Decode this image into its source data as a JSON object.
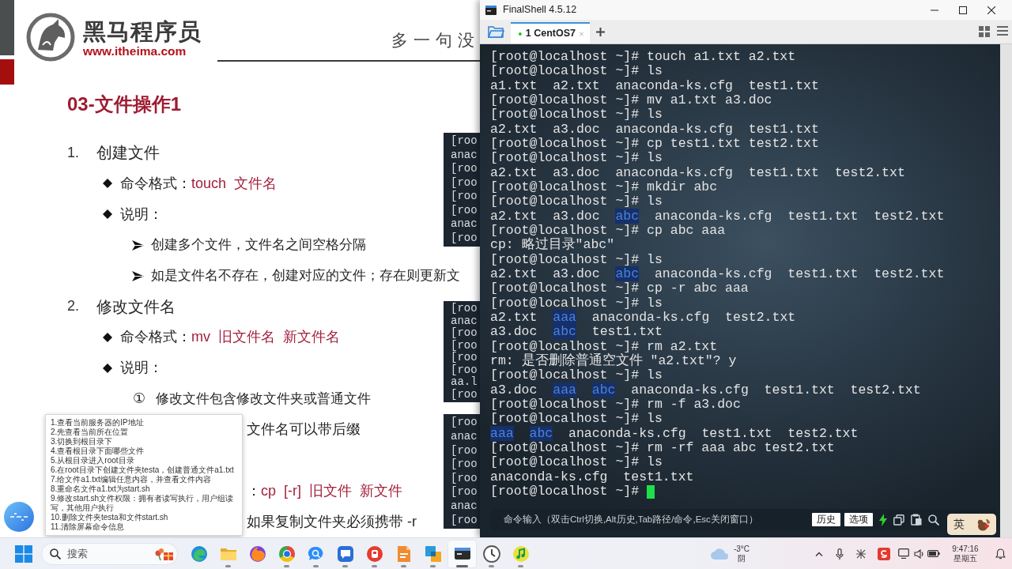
{
  "slide": {
    "logo": {
      "name": "黑马程序员",
      "url": "www.itheima.com"
    },
    "header": "多一句没",
    "title": "03-文件操作1",
    "sections": [
      {
        "number": "1.",
        "heading": "创建文件",
        "items": [
          {
            "kind": "command",
            "label": "命令格式：",
            "command": "touch  文件名"
          },
          {
            "kind": "note",
            "label": "说明：",
            "points": [
              {
                "kind": "arrow",
                "text": "创建多个文件，文件名之间空格分隔"
              },
              {
                "kind": "arrow",
                "text": "如是文件名不存在，创建对应的文件；存在则更新文"
              }
            ]
          }
        ]
      },
      {
        "number": "2.",
        "heading": "修改文件名",
        "items": [
          {
            "kind": "command",
            "label": "命令格式：",
            "command": "mv  旧文件名  新文件名"
          },
          {
            "kind": "note",
            "label": "说明：",
            "points": [
              {
                "kind": "circled",
                "symbol": "①",
                "text": "修改文件包含修改文件夹或普通文件"
              }
            ]
          }
        ]
      }
    ],
    "covered_lines": [
      {
        "kind": "text",
        "text": "文件名可以带后缀"
      },
      {
        "kind": "command",
        "label": "：",
        "command": "cp  [-r]  旧文件  新文件"
      },
      {
        "kind": "text",
        "text": "如果复制文件夹必须携带 -r"
      }
    ],
    "code_blocks": [
      {
        "lines": [
          "[roo",
          "anac",
          "[roo",
          "[roo",
          "[roo",
          "[roo",
          "anac",
          "[roo"
        ]
      },
      {
        "lines": [
          "[roo",
          "anac",
          "[roo",
          "[roo",
          "[roo",
          "[roo",
          "aa.l",
          "[roo"
        ]
      },
      {
        "lines": [
          "[roo",
          "anac",
          "[roo",
          "[roo",
          "[roo",
          "[roo",
          "anac",
          "[roo"
        ]
      }
    ]
  },
  "terminal": {
    "title": "FinalShell 4.5.12",
    "tabs": [
      {
        "label": "1 CentOS7",
        "selected": true,
        "connected": true
      }
    ],
    "lines": [
      {
        "parts": [
          {
            "text": "[root@localhost ~]# touch a1.txt a2.txt",
            "kind": "plain"
          }
        ]
      },
      {
        "parts": [
          {
            "text": "[root@localhost ~]# ls",
            "kind": "plain"
          }
        ]
      },
      {
        "parts": [
          {
            "text": "a1.txt  a2.txt  anaconda-ks.cfg  test1.txt",
            "kind": "plain"
          }
        ]
      },
      {
        "parts": [
          {
            "text": "[root@localhost ~]# mv a1.txt a3.doc",
            "kind": "plain"
          }
        ]
      },
      {
        "parts": [
          {
            "text": "[root@localhost ~]# ls",
            "kind": "plain"
          }
        ]
      },
      {
        "parts": [
          {
            "text": "a2.txt  a3.doc  anaconda-ks.cfg  test1.txt",
            "kind": "plain"
          }
        ]
      },
      {
        "parts": [
          {
            "text": "[root@localhost ~]# cp test1.txt test2.txt",
            "kind": "plain"
          }
        ]
      },
      {
        "parts": [
          {
            "text": "[root@localhost ~]# ls",
            "kind": "plain"
          }
        ]
      },
      {
        "parts": [
          {
            "text": "a2.txt  a3.doc  anaconda-ks.cfg  test1.txt  test2.txt",
            "kind": "plain"
          }
        ]
      },
      {
        "parts": [
          {
            "text": "[root@localhost ~]# mkdir abc",
            "kind": "plain"
          }
        ]
      },
      {
        "parts": [
          {
            "text": "[root@localhost ~]# ls",
            "kind": "plain"
          }
        ]
      },
      {
        "parts": [
          {
            "text": "a2.txt  a3.doc",
            "kind": "plain"
          },
          {
            "text": "abc",
            "kind": "dir"
          },
          {
            "text": "anaconda-ks.cfg  test1.txt  test2.txt",
            "kind": "plain"
          }
        ]
      },
      {
        "parts": [
          {
            "text": "[root@localhost ~]# cp abc aaa",
            "kind": "plain"
          }
        ]
      },
      {
        "parts": [
          {
            "text": "cp: 略过目录\"abc\"",
            "kind": "plain"
          }
        ]
      },
      {
        "parts": [
          {
            "text": "[root@localhost ~]# ls",
            "kind": "plain"
          }
        ]
      },
      {
        "parts": [
          {
            "text": "a2.txt  a3.doc",
            "kind": "plain"
          },
          {
            "text": "abc",
            "kind": "dir"
          },
          {
            "text": "anaconda-ks.cfg  test1.txt  test2.txt",
            "kind": "plain"
          }
        ]
      },
      {
        "parts": [
          {
            "text": "[root@localhost ~]# cp -r abc aaa",
            "kind": "plain"
          }
        ]
      },
      {
        "parts": [
          {
            "text": "[root@localhost ~]# ls",
            "kind": "plain"
          }
        ]
      },
      {
        "parts": [
          {
            "text": "a2.txt",
            "kind": "plain"
          },
          {
            "text": "aaa",
            "kind": "dir"
          },
          {
            "text": "anaconda-ks.cfg  test2.txt",
            "kind": "plain"
          }
        ]
      },
      {
        "parts": [
          {
            "text": "a3.doc",
            "kind": "plain"
          },
          {
            "text": "abc",
            "kind": "dir"
          },
          {
            "text": "test1.txt",
            "kind": "plain"
          }
        ]
      },
      {
        "parts": [
          {
            "text": "[root@localhost ~]# rm a2.txt",
            "kind": "plain"
          }
        ]
      },
      {
        "parts": [
          {
            "text": "rm: 是否删除普通空文件 \"a2.txt\"? y",
            "kind": "plain"
          }
        ]
      },
      {
        "parts": [
          {
            "text": "[root@localhost ~]# ls",
            "kind": "plain"
          }
        ]
      },
      {
        "parts": [
          {
            "text": "a3.doc",
            "kind": "plain"
          },
          {
            "text": "aaa",
            "kind": "dir"
          },
          {
            "text": "abc",
            "kind": "dir"
          },
          {
            "text": "anaconda-ks.cfg  test1.txt  test2.txt",
            "kind": "plain"
          }
        ]
      },
      {
        "parts": [
          {
            "text": "[root@localhost ~]# rm -f a3.doc",
            "kind": "plain"
          }
        ]
      },
      {
        "parts": [
          {
            "text": "[root@localhost ~]# ls",
            "kind": "plain"
          }
        ]
      },
      {
        "parts": [
          {
            "text": "aaa",
            "kind": "dir"
          },
          {
            "text": "abc",
            "kind": "dir"
          },
          {
            "text": "anaconda-ks.cfg  test1.txt  test2.txt",
            "kind": "plain"
          }
        ]
      },
      {
        "parts": [
          {
            "text": "[root@localhost ~]# rm -rf aaa abc test2.txt",
            "kind": "plain"
          }
        ]
      },
      {
        "parts": [
          {
            "text": "[root@localhost ~]# ls",
            "kind": "plain"
          }
        ]
      },
      {
        "parts": [
          {
            "text": "anaconda-ks.cfg  test1.txt",
            "kind": "plain"
          }
        ]
      },
      {
        "parts": [
          {
            "text": "[root@localhost ~]#",
            "kind": "plain"
          }
        ]
      }
    ],
    "cursor_visible": true,
    "command_bar": {
      "placeholder": "命令输入（双击Ctrl切换,Alt历史,Tab路径/命令,Esc关闭窗口）",
      "buttons": [
        "历史",
        "选项"
      ]
    }
  },
  "note": {
    "items": [
      "1.查看当前服务器的IP地址",
      "2.先查看当前所在位置",
      "3.切换到根目录下",
      "4.查看根目录下面哪些文件",
      "5.从根目录进入root目录",
      "6.在root目录下创建文件夹testa，创建普通文件a1.txt",
      "7.给文件a1.txt编辑任意内容，并查看文件内容",
      "8.重命名文件a1.txt为start.sh",
      "9.修改start.sh文件权限：拥有者读写执行，用户组读写，其他用户执行",
      "10.删除文件夹testa和文件start.sh",
      "11.清除屏幕命令信息"
    ]
  },
  "ime": {
    "mode": "英"
  },
  "taskbar": {
    "search": {
      "placeholder": "搜索"
    },
    "apps": [
      {
        "kind": "swirl",
        "running": false,
        "active": false
      },
      {
        "kind": "folder",
        "running": true,
        "active": false
      },
      {
        "kind": "flame-globe",
        "running": false,
        "active": false
      },
      {
        "kind": "segmented-ring",
        "running": true,
        "active": false
      },
      {
        "kind": "chat-bubble",
        "running": true,
        "active": false
      },
      {
        "kind": "chat-window",
        "running": true,
        "active": false
      },
      {
        "kind": "round-badge",
        "running": true,
        "active": false
      },
      {
        "kind": "folded-page",
        "running": true,
        "active": false
      },
      {
        "kind": "overlapping-squares",
        "running": true,
        "active": false
      },
      {
        "kind": "terminal-window",
        "running": true,
        "active": true
      },
      {
        "kind": "clock",
        "running": true,
        "active": false
      },
      {
        "kind": "music-note",
        "running": true,
        "active": false
      }
    ],
    "weather": {
      "temperature": "-3°C",
      "condition": "阴"
    },
    "clock": {
      "time": "9:47:16",
      "day": "星期五"
    }
  }
}
